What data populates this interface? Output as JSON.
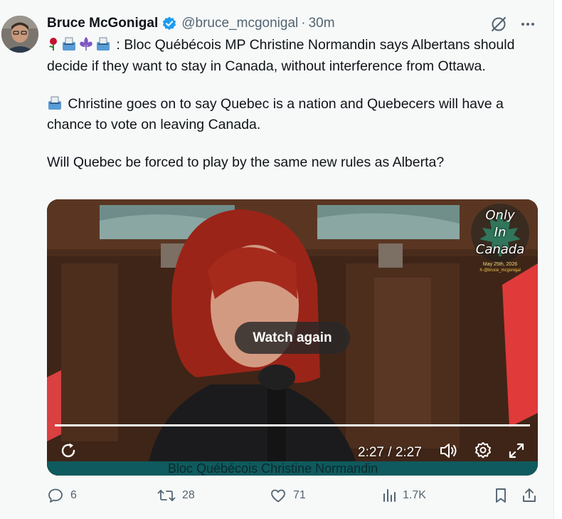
{
  "author": {
    "name": "Bruce McGonigal",
    "handle": "@bruce_mcgonigal",
    "separator": "·",
    "time": "30m"
  },
  "icons": {
    "verified": "verified-badge-icon",
    "grok": "grok-icon",
    "more": "more-icon"
  },
  "tweet": {
    "line1_text": ": Bloc Québécois MP Christine Normandin says Albertans should decide if they want to stay in Canada, without interference from Ottawa.",
    "line2_text": "Christine goes on to say Quebec is a nation and Quebecers will have a chance to vote on leaving Canada.",
    "line3_text": "Will Quebec be forced to play by the same new rules as Alberta?"
  },
  "media": {
    "watermark_line1": "Only",
    "watermark_line2": "In",
    "watermark_line3": "Canada",
    "watermark_date": "May 25th, 2026",
    "watermark_handle": "X-@bruce_mcgonigal",
    "watch_again_label": "Watch again",
    "progress": 1.0,
    "time_readout": "2:27 / 2:27",
    "caption": "Bloc Québécois Christine Normandin"
  },
  "actions": {
    "replies": "6",
    "reposts": "28",
    "likes": "71",
    "views": "1.7K"
  },
  "colors": {
    "text": "#0f1419",
    "secondary": "#536471",
    "verified": "#1d9bf0",
    "background": "#f7f9f9"
  }
}
